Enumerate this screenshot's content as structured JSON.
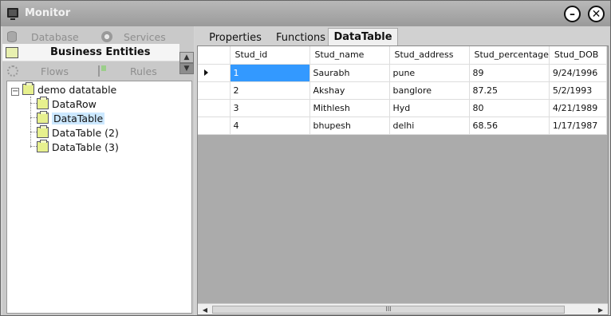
{
  "window": {
    "title": "Monitor",
    "minimize_glyph": "–",
    "close_glyph": "✕"
  },
  "left_nav": {
    "database_label": "Database",
    "services_label": "Services",
    "business_entities_label": "Business Entities",
    "flows_label": "Flows",
    "rules_label": "Rules"
  },
  "tree": {
    "root": "demo datatable",
    "children": [
      "DataRow",
      "DataTable",
      "DataTable (2)",
      "DataTable (3)"
    ],
    "selected": "DataTable"
  },
  "tabs": [
    "Properties",
    "Functions",
    "DataTable"
  ],
  "active_tab": "DataTable",
  "grid": {
    "columns": [
      "Stud_id",
      "Stud_name",
      "Stud_address",
      "Stud_percentage",
      "Stud_DOB"
    ],
    "rows": [
      [
        "1",
        "Saurabh",
        "pune",
        "89",
        "9/24/1996"
      ],
      [
        "2",
        "Akshay",
        "banglore",
        "87.25",
        "5/2/1993"
      ],
      [
        "3",
        "Mithlesh",
        "Hyd",
        "80",
        "4/21/1989"
      ],
      [
        "4",
        "bhupesh",
        "delhi",
        "68.56",
        "1/17/1987"
      ]
    ],
    "scroll_thumb_glyph": "III"
  },
  "colors": {
    "selected_cell": "#3399ff",
    "grid_background": "#ababab"
  }
}
